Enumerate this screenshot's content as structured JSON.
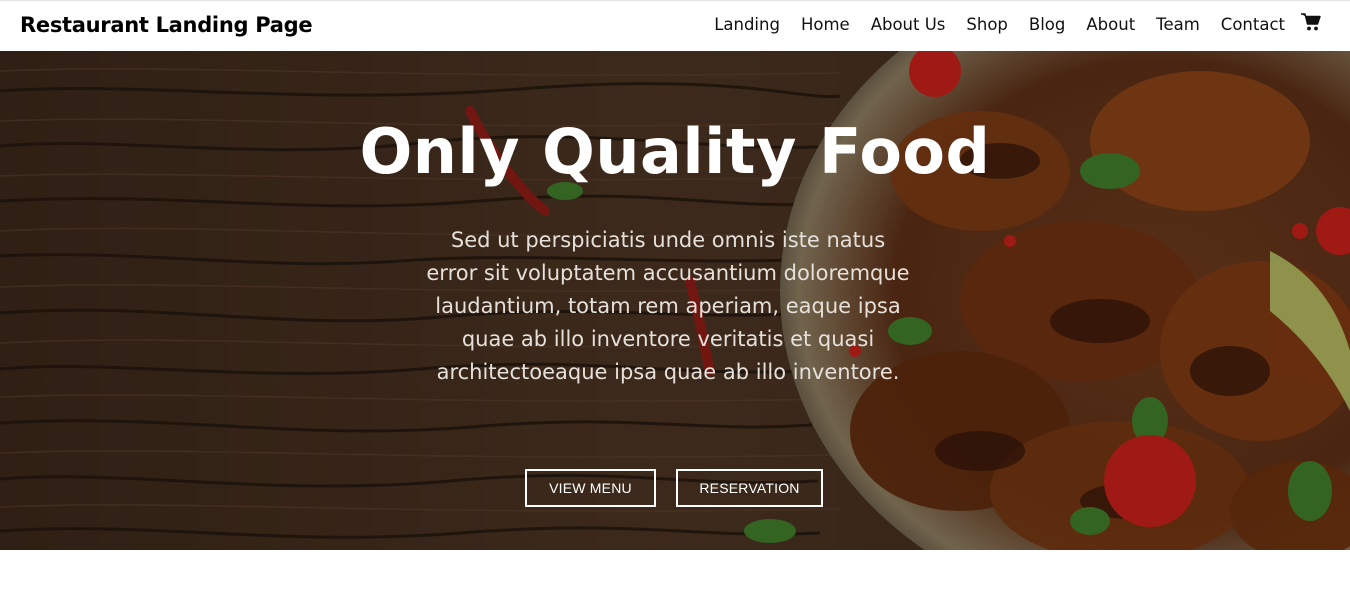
{
  "header": {
    "brand": "Restaurant Landing Page",
    "nav": [
      "Landing",
      "Home",
      "About Us",
      "Shop",
      "Blog",
      "About",
      "Team",
      "Contact"
    ],
    "cart_icon": "shopping-cart-icon"
  },
  "hero": {
    "title": "Only Quality Food",
    "description": "Sed ut perspiciatis unde omnis iste natus error sit voluptatem accusantium doloremque laudantium, totam rem aperiam, eaque ipsa quae ab illo inventore veritatis et quasi architectoeaque ipsa quae ab illo inventore.",
    "buttons": {
      "view_menu": "VIEW MENU",
      "reservation": "RESERVATION"
    }
  },
  "colors": {
    "header_bg": "#ffffff",
    "text_dark": "#111111",
    "hero_text": "#ffffff",
    "button_border": "#ffffff"
  }
}
